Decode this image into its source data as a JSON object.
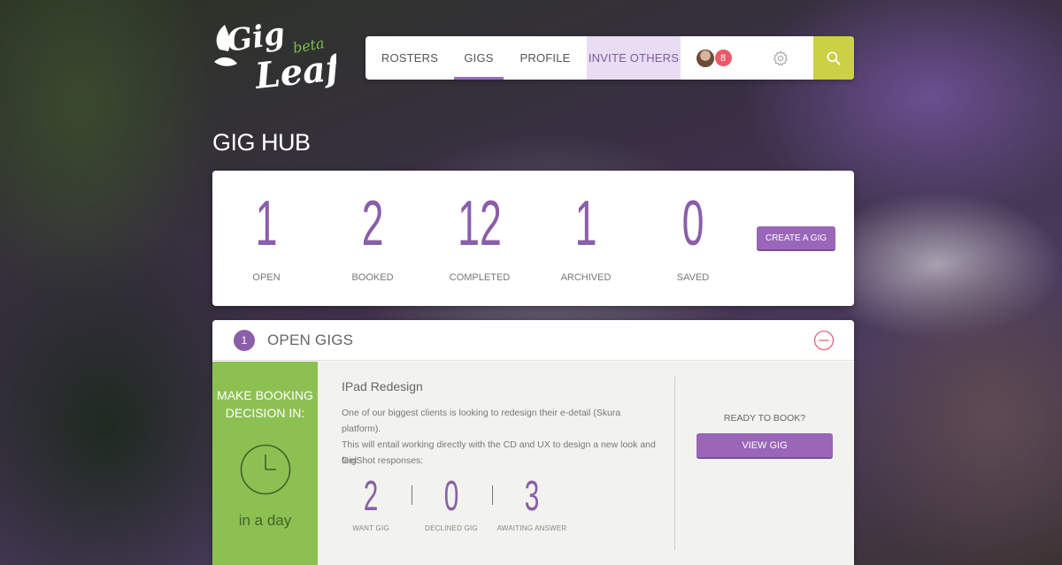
{
  "brand": {
    "logo_text": "Gig Leaf",
    "logo_badge": "beta"
  },
  "nav": {
    "items": [
      {
        "label": "ROSTERS"
      },
      {
        "label": "GIGS",
        "active": true
      },
      {
        "label": "PROFILE"
      },
      {
        "label": "INVITE OTHERS"
      }
    ],
    "notification_count": "8",
    "icons": [
      "avatar",
      "gear-icon",
      "search-icon"
    ],
    "search_color": "#cbd045"
  },
  "page": {
    "title": "GIG HUB"
  },
  "stats": [
    {
      "value": "1",
      "label": "OPEN"
    },
    {
      "value": "2",
      "label": "BOOKED"
    },
    {
      "value": "12",
      "label": "COMPLETED"
    },
    {
      "value": "1",
      "label": "ARCHIVED"
    },
    {
      "value": "0",
      "label": "SAVED"
    }
  ],
  "create_button": "CREATE A GIG",
  "open_gigs": {
    "count": "1",
    "title": "OPEN GIGS",
    "gig": {
      "decision_label": "MAKE BOOKING DECISION IN:",
      "decision_time": "in a day",
      "title": "IPad Redesign",
      "description_line1": "One of our biggest clients is looking to redesign their e-detail (Skura platform).",
      "description_line2": "This will entail working directly with the CD and UX to design a new look and feel.",
      "responses_label": "GigShot responses:",
      "responses": [
        {
          "value": "2",
          "label": "WANT GIG"
        },
        {
          "value": "0",
          "label": "DECLINED GIG"
        },
        {
          "value": "3",
          "label": "AWAITING ANSWER"
        }
      ],
      "ready_label": "READY TO BOOK?",
      "view_button": "VIEW GIG"
    }
  },
  "colors": {
    "accent": "#9966b8",
    "green": "#8cc152",
    "badge": "#e85a68"
  }
}
